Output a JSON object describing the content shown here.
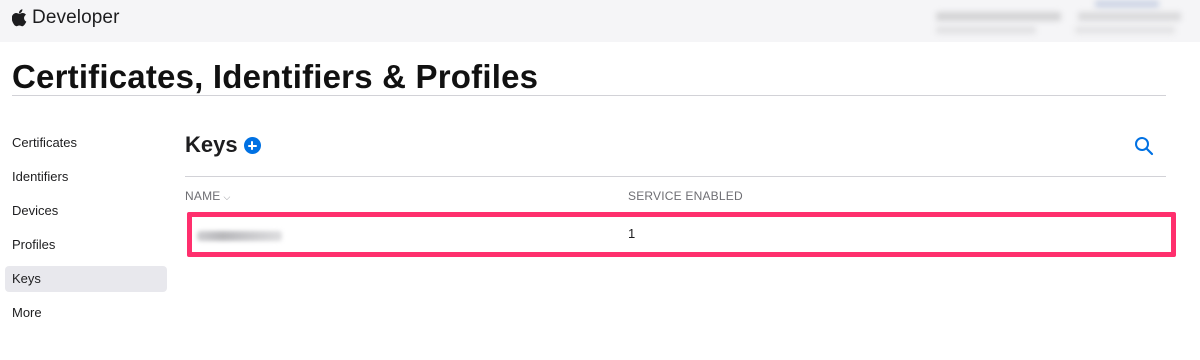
{
  "header": {
    "brand_label": "Developer",
    "logo_icon": "apple-logo-icon"
  },
  "page": {
    "title": "Certificates, Identifiers & Profiles"
  },
  "sidebar": {
    "items": [
      {
        "label": "Certificates",
        "active": false
      },
      {
        "label": "Identifiers",
        "active": false
      },
      {
        "label": "Devices",
        "active": false
      },
      {
        "label": "Profiles",
        "active": false
      },
      {
        "label": "Keys",
        "active": true
      },
      {
        "label": "More",
        "active": false
      }
    ]
  },
  "keys": {
    "title": "Keys",
    "add_icon": "plus-circle-icon",
    "search_icon": "search-icon",
    "columns": {
      "name": "NAME",
      "service": "SERVICE ENABLED"
    },
    "rows": [
      {
        "name": "",
        "service_enabled": "1"
      }
    ]
  },
  "colors": {
    "accent": "#0071e3",
    "highlight_border": "#ff2f6d",
    "active_nav_bg": "#e8e8ed"
  }
}
